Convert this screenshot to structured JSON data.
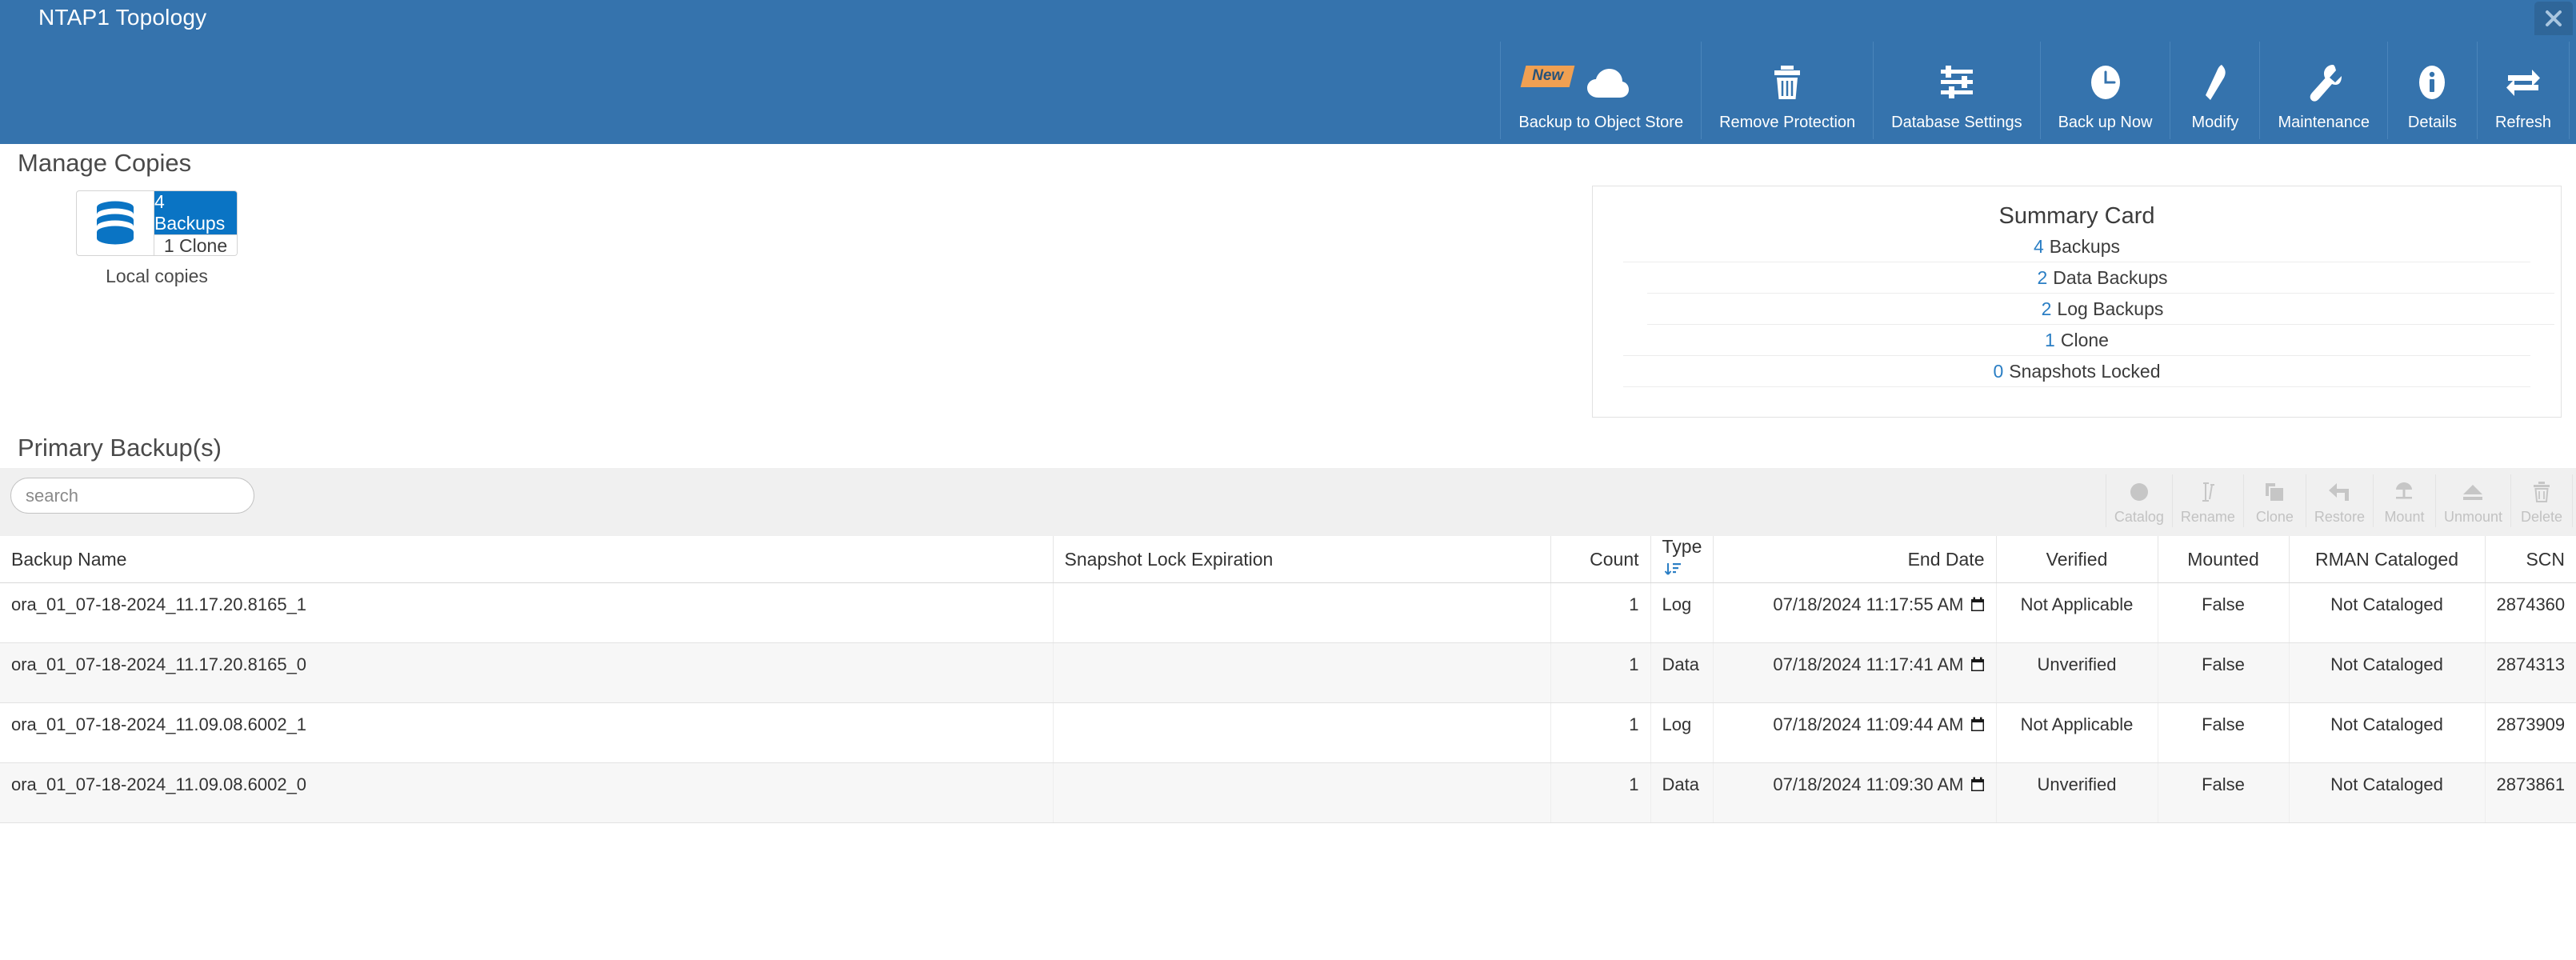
{
  "window": {
    "title": "NTAP1 Topology",
    "close_icon": "close-icon"
  },
  "toolbar": {
    "items": [
      {
        "label": "Backup to Object Store",
        "icon": "cloud-icon",
        "badge": "New"
      },
      {
        "label": "Remove Protection",
        "icon": "trash-icon"
      },
      {
        "label": "Database Settings",
        "icon": "sliders-icon"
      },
      {
        "label": "Back up Now",
        "icon": "clock-icon"
      },
      {
        "label": "Modify",
        "icon": "pencil-icon"
      },
      {
        "label": "Maintenance",
        "icon": "wrench-icon"
      },
      {
        "label": "Details",
        "icon": "info-icon"
      },
      {
        "label": "Refresh",
        "icon": "refresh-arrows-icon"
      }
    ]
  },
  "manage_copies": {
    "title": "Manage Copies",
    "local": {
      "db_icon": "database-icon",
      "backups_label": "4 Backups",
      "clone_label": "1 Clone",
      "caption": "Local copies"
    }
  },
  "summary_card": {
    "title": "Summary Card",
    "rows": [
      {
        "num": "4",
        "text": "Backups",
        "level": 0
      },
      {
        "num": "2",
        "text": "Data Backups",
        "level": 1
      },
      {
        "num": "2",
        "text": "Log Backups",
        "level": 1
      },
      {
        "num": "1",
        "text": "Clone",
        "level": 0
      },
      {
        "num": "0",
        "text": "Snapshots Locked",
        "level": 0
      }
    ]
  },
  "primary_backups": {
    "title": "Primary Backup(s)",
    "search": {
      "value": "",
      "placeholder": "search"
    },
    "filter_icon": "funnel-icon",
    "row_actions": [
      {
        "label": "Catalog",
        "icon": "catalog-circle-icon"
      },
      {
        "label": "Rename",
        "icon": "rename-text-cursor-icon"
      },
      {
        "label": "Clone",
        "icon": "clone-copy-icon"
      },
      {
        "label": "Restore",
        "icon": "restore-undo-arrow-icon"
      },
      {
        "label": "Mount",
        "icon": "mount-icon"
      },
      {
        "label": "Unmount",
        "icon": "unmount-eject-icon"
      },
      {
        "label": "Delete",
        "icon": "trash-icon"
      }
    ],
    "columns": [
      {
        "label": "Backup Name",
        "align": "left",
        "sorted": false
      },
      {
        "label": "Snapshot Lock Expiration",
        "align": "left",
        "sorted": false
      },
      {
        "label": "Count",
        "align": "right",
        "sorted": false
      },
      {
        "label": "Type",
        "align": "left",
        "sorted": true
      },
      {
        "label": "End Date",
        "align": "right",
        "sorted": false
      },
      {
        "label": "Verified",
        "align": "center",
        "sorted": false
      },
      {
        "label": "Mounted",
        "align": "center",
        "sorted": false
      },
      {
        "label": "RMAN Cataloged",
        "align": "center",
        "sorted": false
      },
      {
        "label": "SCN",
        "align": "right",
        "sorted": false
      }
    ],
    "rows": [
      {
        "backup_name": "ora_01_07-18-2024_11.17.20.8165_1",
        "snapshot_lock_expiration": "",
        "count": "1",
        "type": "Log",
        "end_date": "07/18/2024 11:17:55 AM",
        "verified": "Not Applicable",
        "mounted": "False",
        "rman_cataloged": "Not Cataloged",
        "scn": "2874360"
      },
      {
        "backup_name": "ora_01_07-18-2024_11.17.20.8165_0",
        "snapshot_lock_expiration": "",
        "count": "1",
        "type": "Data",
        "end_date": "07/18/2024 11:17:41 AM",
        "verified": "Unverified",
        "mounted": "False",
        "rman_cataloged": "Not Cataloged",
        "scn": "2874313"
      },
      {
        "backup_name": "ora_01_07-18-2024_11.09.08.6002_1",
        "snapshot_lock_expiration": "",
        "count": "1",
        "type": "Log",
        "end_date": "07/18/2024 11:09:44 AM",
        "verified": "Not Applicable",
        "mounted": "False",
        "rman_cataloged": "Not Cataloged",
        "scn": "2873909"
      },
      {
        "backup_name": "ora_01_07-18-2024_11.09.08.6002_0",
        "snapshot_lock_expiration": "",
        "count": "1",
        "type": "Data",
        "end_date": "07/18/2024 11:09:30 AM",
        "verified": "Unverified",
        "mounted": "False",
        "rman_cataloged": "Not Cataloged",
        "scn": "2873861"
      }
    ]
  },
  "colors": {
    "header_blue": "#3573ad",
    "accent_blue": "#0a74c4",
    "link_blue": "#2a7ec4",
    "badge_orange": "#f0a052"
  }
}
